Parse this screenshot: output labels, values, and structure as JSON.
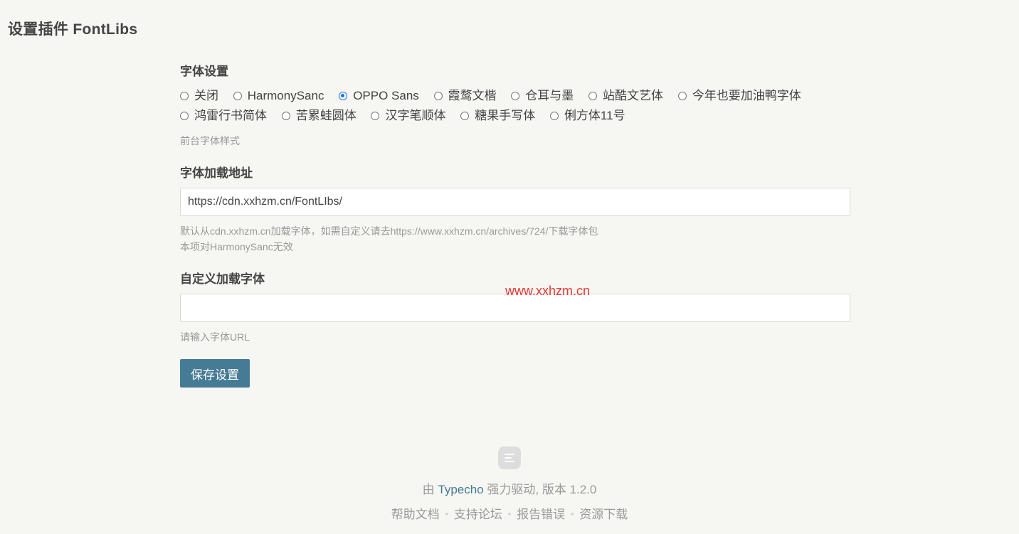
{
  "page": {
    "title": "设置插件 FontLibs"
  },
  "font_setting": {
    "label": "字体设置",
    "options": [
      "关闭",
      "HarmonySanc",
      "OPPO Sans",
      "霞鹜文楷",
      "仓耳与墨",
      "站酷文艺体",
      "今年也要加油鸭字体",
      "鸿雷行书简体",
      "苦累蛙圆体",
      "汉字笔顺体",
      "糖果手写体",
      "俐方体11号"
    ],
    "selected": "OPPO Sans",
    "description": "前台字体样式"
  },
  "font_url": {
    "label": "字体加载地址",
    "value": "https://cdn.xxhzm.cn/FontLIbs/",
    "description_line1": "默认从cdn.xxhzm.cn加载字体，如需自定义请去https://www.xxhzm.cn/archives/724/下载字体包",
    "description_line2": "本项对HarmonySanc无效"
  },
  "custom_font": {
    "label": "自定义加载字体",
    "value": "",
    "description": "请输入字体URL"
  },
  "save_button": {
    "label": "保存设置"
  },
  "watermark": "www.xxhzm.cn",
  "footer": {
    "logo_icon": "typecho-logo-icon",
    "powered_prefix": "由",
    "powered_link": "Typecho",
    "powered_suffix": "强力驱动, 版本 1.2.0",
    "links": [
      "帮助文档",
      "支持论坛",
      "报告错误",
      "资源下载"
    ]
  },
  "colors": {
    "background": "#f6f6f3",
    "button": "#467b96",
    "link": "#467b96",
    "watermark": "#e53935",
    "radio_checked": "#1a73e8"
  }
}
